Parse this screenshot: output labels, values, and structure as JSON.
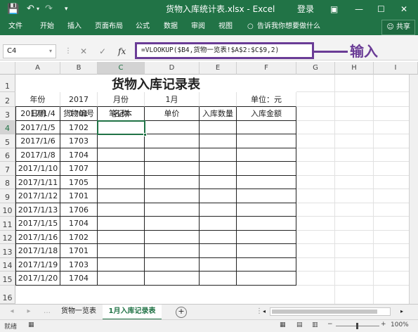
{
  "window": {
    "title": "货物入库统计表.xlsx - Excel",
    "login_label": "登录",
    "save_icon": "save-icon",
    "undo_icon": "undo-icon",
    "redo_icon": "redo-icon",
    "minimize": "—",
    "restore": "☐",
    "close": "✕",
    "ribbon_options": "▣"
  },
  "ribbon": {
    "tabs": [
      "文件",
      "开始",
      "插入",
      "页面布局",
      "公式",
      "数据",
      "审阅",
      "视图"
    ],
    "tell_me": "告诉我你想要做什么",
    "share_label": "共享"
  },
  "formula_bar": {
    "name_box": "C4",
    "fx_label": "fx",
    "cancel": "✕",
    "enter": "✓",
    "formula": "=VLOOKUP($B4,货物一览表!$A$2:$C$9,2)",
    "callout": "输入",
    "callout_color": "#6a3c96"
  },
  "sheet": {
    "columns": [
      "A",
      "B",
      "C",
      "D",
      "E",
      "F",
      "G",
      "H",
      "I"
    ],
    "row_numbers": [
      "1",
      "2",
      "3",
      "4",
      "5",
      "6",
      "7",
      "8",
      "9",
      "10",
      "11",
      "12",
      "13",
      "14",
      "15",
      "16"
    ],
    "title": "货物入库记录表",
    "row2": {
      "a": "年份",
      "b": "2017",
      "c": "月份",
      "d": "1月",
      "f": "单位：元"
    },
    "headers": [
      "日期",
      "货物编号",
      "名称",
      "单价",
      "入库数量",
      "入库金额"
    ],
    "records": [
      {
        "date": "2017/1/4",
        "code": "1701",
        "name": "笔记本"
      },
      {
        "date": "2017/1/5",
        "code": "1702",
        "name": ""
      },
      {
        "date": "2017/1/6",
        "code": "1703",
        "name": ""
      },
      {
        "date": "2017/1/8",
        "code": "1704",
        "name": ""
      },
      {
        "date": "2017/1/10",
        "code": "1707",
        "name": ""
      },
      {
        "date": "2017/1/11",
        "code": "1705",
        "name": ""
      },
      {
        "date": "2017/1/12",
        "code": "1701",
        "name": ""
      },
      {
        "date": "2017/1/13",
        "code": "1706",
        "name": ""
      },
      {
        "date": "2017/1/15",
        "code": "1704",
        "name": ""
      },
      {
        "date": "2017/1/16",
        "code": "1702",
        "name": ""
      },
      {
        "date": "2017/1/18",
        "code": "1701",
        "name": ""
      },
      {
        "date": "2017/1/19",
        "code": "1703",
        "name": ""
      },
      {
        "date": "2017/1/20",
        "code": "1704",
        "name": ""
      }
    ]
  },
  "sheet_tabs": {
    "tabs": [
      "货物一览表",
      "1月入库记录表"
    ],
    "active_index": 1,
    "add_icon": "add-sheet-icon"
  },
  "status": {
    "ready": "就绪",
    "zoom": "100%",
    "zoom_minus": "−",
    "zoom_plus": "+"
  },
  "colors": {
    "excel_green": "#217346",
    "callout_purple": "#6a3c96"
  }
}
